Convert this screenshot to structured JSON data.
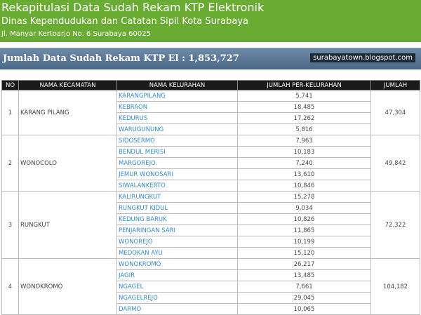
{
  "header": {
    "title": "Rekapitulasi Data Sudah Rekam KTP Elektronik",
    "subtitle": "Dinas Kependudukan dan Catatan Sipil Kota Surabaya",
    "address": "Jl. Manyar Kertoarjo No. 6 Surabaya 60025"
  },
  "banner": {
    "title": "Jumlah Data Sudah Rekam KTP El : 1,853,727",
    "blog": "surabayatown.blogspot.com"
  },
  "table": {
    "headers": [
      "NO",
      "NAMA KECAMATAN",
      "NAMA KELURAHAN",
      "JUMLAH PER-KELURAHAN",
      "JUMLAH"
    ],
    "groups": [
      {
        "no": "1",
        "kecamatan": "KARANG PILANG",
        "total": "47,304",
        "rows": [
          [
            "KARANGPILANG",
            "5,741"
          ],
          [
            "KEBRAON",
            "18,485"
          ],
          [
            "KEDURUS",
            "17,262"
          ],
          [
            "WARUGUNUNG",
            "5,816"
          ]
        ]
      },
      {
        "no": "2",
        "kecamatan": "WONOCOLO",
        "total": "49,842",
        "rows": [
          [
            "SIDOSERMO",
            "7,963"
          ],
          [
            "BENDUL MERISI",
            "10,183"
          ],
          [
            "MARGOREJO",
            "7,240"
          ],
          [
            "JEMUR WONOSARI",
            "13,610"
          ],
          [
            "SIWALANKERTO",
            "10,846"
          ]
        ]
      },
      {
        "no": "3",
        "kecamatan": "RUNGKUT",
        "total": "72,322",
        "rows": [
          [
            "KALIRUNGKUT",
            "15,278"
          ],
          [
            "RUNGKUT KIDUL",
            "9,034"
          ],
          [
            "KEDUNG BARUK",
            "10,826"
          ],
          [
            "PENJARINGAN SARI",
            "11,865"
          ],
          [
            "WONOREJO",
            "10,199"
          ],
          [
            "MEDOKAN AYU",
            "15,120"
          ]
        ]
      },
      {
        "no": "4",
        "kecamatan": "WONOKROMO",
        "total": "104,182",
        "rows": [
          [
            "WONOKROMO",
            "26,217"
          ],
          [
            "JAGIR",
            "13,485"
          ],
          [
            "NGAGEL",
            "7,661"
          ],
          [
            "NGAGELREJO",
            "29,045"
          ],
          [
            "DARMO",
            "10,065"
          ]
        ]
      }
    ]
  }
}
